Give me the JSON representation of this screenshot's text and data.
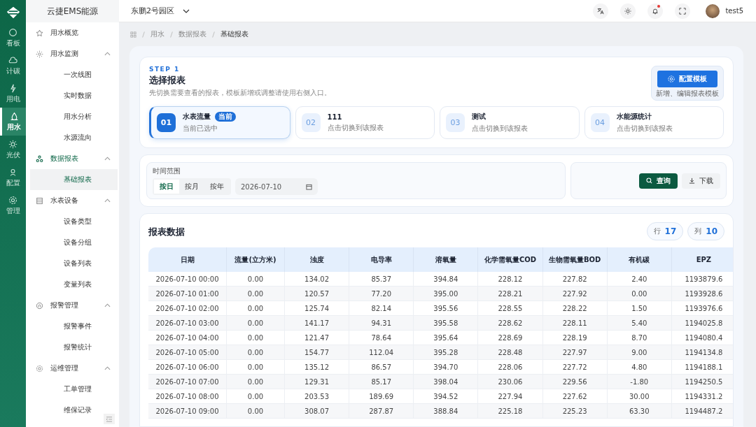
{
  "brand": "云捷EMS能源",
  "rail": [
    {
      "label": "看板",
      "selected": false
    },
    {
      "label": "计碳",
      "selected": false
    },
    {
      "label": "用电",
      "selected": false
    },
    {
      "label": "用水",
      "selected": true
    },
    {
      "label": "光伏",
      "selected": false
    },
    {
      "label": "配置",
      "selected": false
    },
    {
      "label": "管理",
      "selected": false
    }
  ],
  "menu": [
    {
      "label": "用水概览",
      "active": false
    },
    {
      "label": "用水监测",
      "active": false,
      "expanded": true,
      "children": [
        {
          "label": "一次线图",
          "selected": false
        },
        {
          "label": "实时数据",
          "selected": false
        },
        {
          "label": "用水分析",
          "selected": false
        },
        {
          "label": "水源流向",
          "selected": false
        }
      ]
    },
    {
      "label": "数据报表",
      "active": true,
      "expanded": true,
      "children": [
        {
          "label": "基础报表",
          "selected": true
        }
      ]
    },
    {
      "label": "水表设备",
      "active": false,
      "expanded": true,
      "children": [
        {
          "label": "设备类型",
          "selected": false
        },
        {
          "label": "设备分组",
          "selected": false
        },
        {
          "label": "设备列表",
          "selected": false
        },
        {
          "label": "变量列表",
          "selected": false
        }
      ]
    },
    {
      "label": "报警管理",
      "active": false,
      "expanded": true,
      "children": [
        {
          "label": "报警事件",
          "selected": false
        },
        {
          "label": "报警统计",
          "selected": false
        }
      ]
    },
    {
      "label": "运维管理",
      "active": false,
      "expanded": true,
      "children": [
        {
          "label": "工单管理",
          "selected": false
        },
        {
          "label": "维保记录",
          "selected": false
        }
      ]
    }
  ],
  "header": {
    "site": "东鹏2号园区",
    "user": "test5",
    "notification_dot": true
  },
  "breadcrumb": [
    "用水",
    "数据报表",
    "基础报表"
  ],
  "step": {
    "eyebrow": "STEP 1",
    "title": "选择报表",
    "hint": "先切换需要查看的报表，模板新增或调整请使用右侧入口。",
    "config_button": "配置模板",
    "config_hint": "新增、编辑报表模板"
  },
  "reports": [
    {
      "number": "01",
      "name": "水表流量",
      "badge": "当前",
      "sub": "当前已选中",
      "selected": true
    },
    {
      "number": "02",
      "name": "111",
      "sub": "点击切换到该报表",
      "selected": false
    },
    {
      "number": "03",
      "name": "测试",
      "sub": "点击切换到该报表",
      "selected": false
    },
    {
      "number": "04",
      "name": "水能源统计",
      "sub": "点击切换到该报表",
      "selected": false
    }
  ],
  "filter": {
    "label": "时间范围",
    "modes": [
      {
        "label": "按日",
        "selected": true
      },
      {
        "label": "按月",
        "selected": false
      },
      {
        "label": "按年",
        "selected": false
      }
    ],
    "date": "2026-07-10",
    "query": "查询",
    "download": "下载"
  },
  "table": {
    "title": "报表数据",
    "rows_label": "行",
    "rows_count": "17",
    "cols_label": "列",
    "cols_count": "10",
    "columns": [
      "日期",
      "流量(立方米)",
      "浊度",
      "电导率",
      "溶氧量",
      "化学需氧量COD",
      "生物需氧量BOD",
      "有机碳",
      "EPZ"
    ],
    "rows": [
      [
        "2026-07-10 00:00",
        "0.00",
        "134.02",
        "85.37",
        "394.84",
        "228.12",
        "227.82",
        "2.40",
        "1193879.6"
      ],
      [
        "2026-07-10 01:00",
        "0.00",
        "120.57",
        "77.20",
        "395.00",
        "228.21",
        "227.92",
        "0.00",
        "1193928.6"
      ],
      [
        "2026-07-10 02:00",
        "0.00",
        "125.74",
        "82.14",
        "395.56",
        "228.55",
        "228.22",
        "1.50",
        "1193976.6"
      ],
      [
        "2026-07-10 03:00",
        "0.00",
        "141.17",
        "94.31",
        "395.58",
        "228.62",
        "228.11",
        "5.40",
        "1194025.8"
      ],
      [
        "2026-07-10 04:00",
        "0.00",
        "121.47",
        "78.64",
        "395.64",
        "228.69",
        "228.19",
        "8.70",
        "1194080.4"
      ],
      [
        "2026-07-10 05:00",
        "0.00",
        "154.77",
        "112.04",
        "395.28",
        "228.48",
        "227.97",
        "9.00",
        "1194134.8"
      ],
      [
        "2026-07-10 06:00",
        "0.00",
        "135.12",
        "86.57",
        "394.70",
        "228.06",
        "227.72",
        "4.80",
        "1194188.1"
      ],
      [
        "2026-07-10 07:00",
        "0.00",
        "129.31",
        "85.17",
        "398.04",
        "230.06",
        "229.56",
        "-1.80",
        "1194250.5"
      ],
      [
        "2026-07-10 08:00",
        "0.00",
        "203.53",
        "189.69",
        "394.52",
        "227.94",
        "227.62",
        "30.00",
        "1194331.2"
      ],
      [
        "2026-07-10 09:00",
        "0.00",
        "308.07",
        "287.87",
        "388.84",
        "225.18",
        "225.23",
        "63.30",
        "1194487.2"
      ]
    ]
  }
}
